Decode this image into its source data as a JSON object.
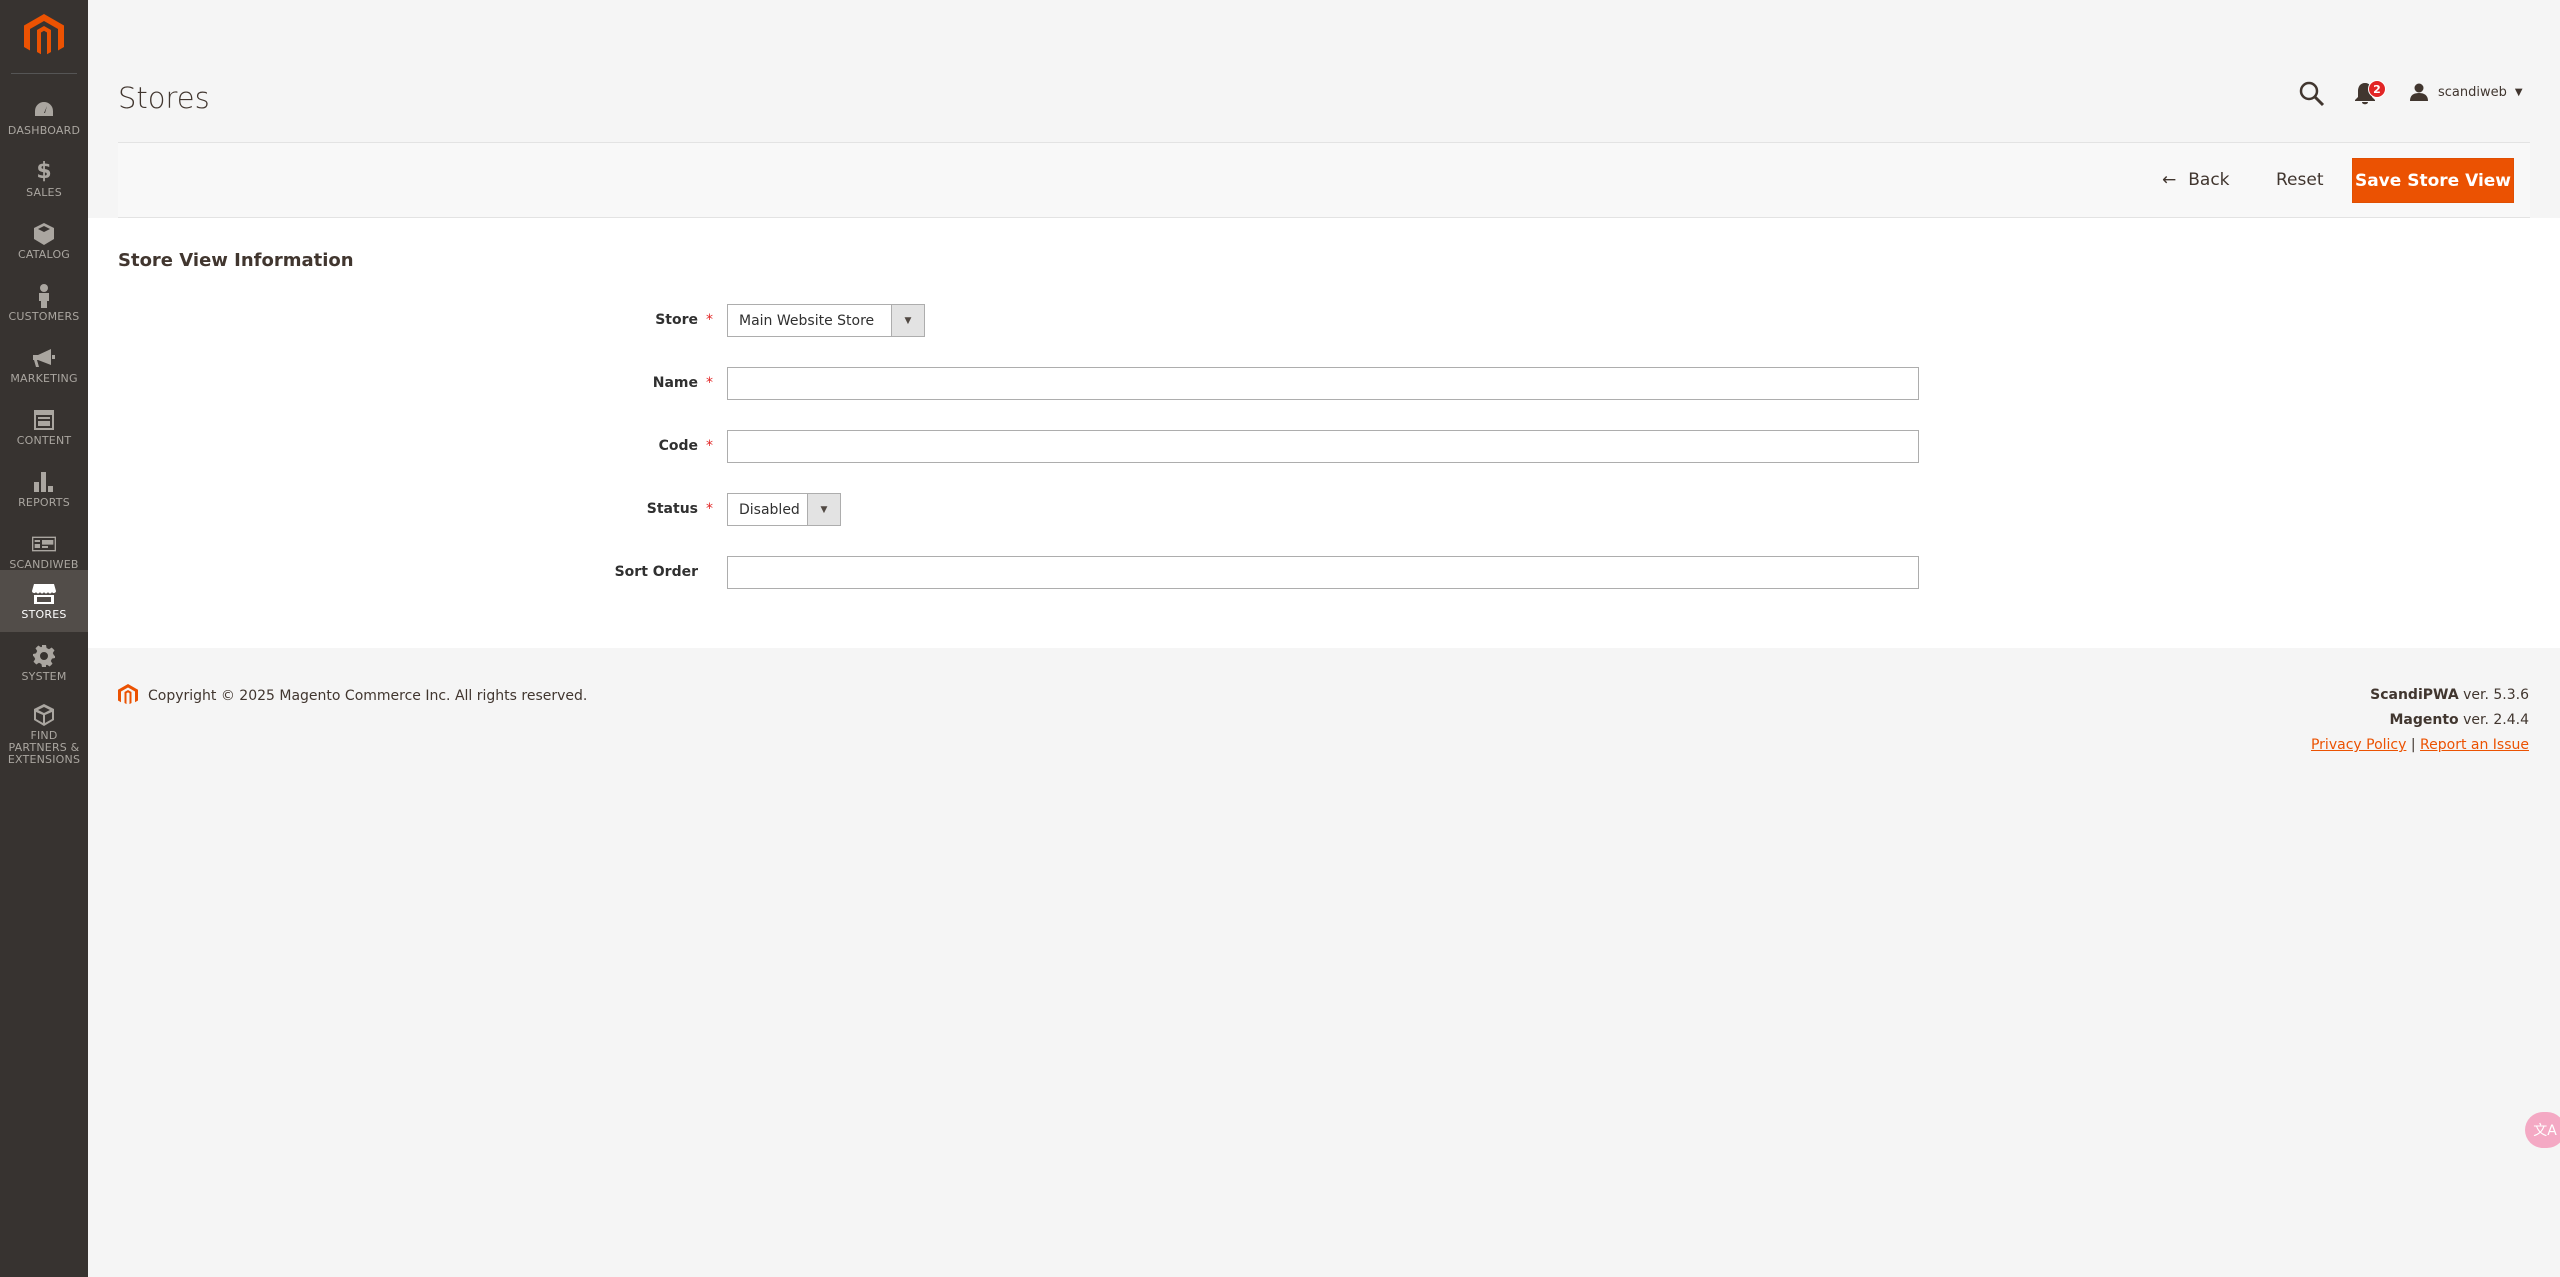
{
  "sidebar": {
    "logo": "magento-logo",
    "items": [
      {
        "label": "DASHBOARD",
        "icon": "dashboard-icon"
      },
      {
        "label": "SALES",
        "icon": "dollar-icon"
      },
      {
        "label": "CATALOG",
        "icon": "box-icon"
      },
      {
        "label": "CUSTOMERS",
        "icon": "person-icon"
      },
      {
        "label": "MARKETING",
        "icon": "megaphone-icon"
      },
      {
        "label": "CONTENT",
        "icon": "layout-icon"
      },
      {
        "label": "REPORTS",
        "icon": "bar-chart-icon"
      },
      {
        "label": "SCANDIWEB",
        "icon": "scandiweb-icon"
      },
      {
        "label": "STORES",
        "icon": "store-icon",
        "active": true
      },
      {
        "label": "SYSTEM",
        "icon": "gear-icon"
      },
      {
        "label": "FIND PARTNERS & EXTENSIONS",
        "icon": "cube-icon"
      }
    ]
  },
  "header": {
    "title": "Stores",
    "notification_count": "2",
    "user_name": "scandiweb"
  },
  "actions": {
    "back_label": "Back",
    "reset_label": "Reset",
    "save_label": "Save Store View"
  },
  "form": {
    "section_title": "Store View Information",
    "store": {
      "label": "Store",
      "value": "Main Website Store",
      "required": true
    },
    "name": {
      "label": "Name",
      "value": "",
      "required": true
    },
    "code": {
      "label": "Code",
      "value": "",
      "required": true
    },
    "status": {
      "label": "Status",
      "value": "Disabled",
      "required": true
    },
    "sort_order": {
      "label": "Sort Order",
      "value": ""
    }
  },
  "footer": {
    "copyright": "Copyright © 2025 Magento Commerce Inc. All rights reserved.",
    "scandipwa_name": "ScandiPWA",
    "scandipwa_version": " ver. 5.3.6",
    "magento_name": "Magento",
    "magento_version": " ver. 2.4.4",
    "privacy_label": "Privacy Policy",
    "separator": "|",
    "report_label": "Report an Issue"
  },
  "colors": {
    "accent": "#eb5202",
    "sidebar_bg": "#373330",
    "sidebar_active": "#524d49",
    "required": "#e22626"
  }
}
